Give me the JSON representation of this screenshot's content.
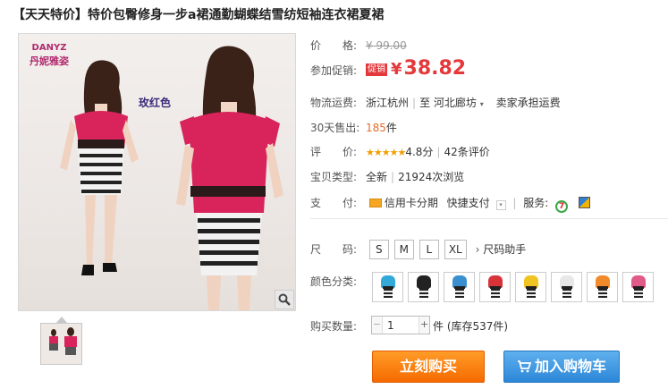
{
  "title": "【天天特价】特价包臀修身一步a裙通勤蝴蝶结雪纺短袖连衣裙夏裙",
  "image": {
    "logo_line1": "DANYZ",
    "logo_line2": "丹妮雅姿",
    "color_label": "玫红色"
  },
  "price": {
    "label": "价　　格:",
    "value": "¥ 99.00"
  },
  "promo": {
    "label": "参加促销:",
    "tag": "促销",
    "currency": "¥",
    "value": "38.82"
  },
  "shipping": {
    "label": "物流运费:",
    "from": "浙江杭州",
    "to_prefix": "至",
    "to": "河北廊坊",
    "fee": "卖家承担运费"
  },
  "sales": {
    "label": "30天售出:",
    "count": "185",
    "unit": "件"
  },
  "rating": {
    "label": "评　　价:",
    "stars": "★★★★★",
    "score": "4.8分",
    "reviews": "42条评价"
  },
  "type": {
    "label": "宝贝类型:",
    "condition": "全新",
    "views": "21924次浏览"
  },
  "payment": {
    "label": "支　　付:",
    "credit": "信用卡分期",
    "quick": "快捷支付",
    "service_label": "服务:"
  },
  "size": {
    "label": "尺　　码:",
    "options": [
      "S",
      "M",
      "L",
      "XL"
    ],
    "helper": "尺码助手"
  },
  "colors": {
    "label": "颜色分类:",
    "swatches": [
      "#33a9d9",
      "#222222",
      "#3a8fd0",
      "#d9333a",
      "#f0c420",
      "#e8e8e8",
      "#f08a2a",
      "#e05a8a"
    ]
  },
  "quantity": {
    "label": "购买数量:",
    "value": "1",
    "unit": "件",
    "stock": "(库存537件)"
  },
  "buttons": {
    "buy": "立刻购买",
    "cart": "加入购物车"
  }
}
